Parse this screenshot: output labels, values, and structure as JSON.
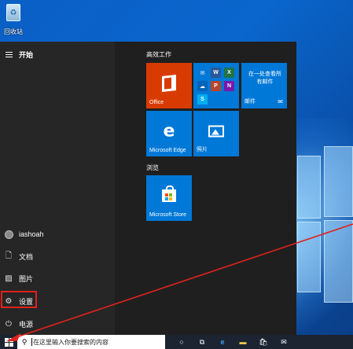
{
  "desktop": {
    "recycle_bin_label": "回收站"
  },
  "start_menu": {
    "header_label": "开始",
    "user_name": "iashoah",
    "nav_items": [
      {
        "label": "文档",
        "icon": "document-icon"
      },
      {
        "label": "图片",
        "icon": "pictures-icon"
      },
      {
        "label": "设置",
        "icon": "gear-icon"
      },
      {
        "label": "电源",
        "icon": "power-icon"
      }
    ],
    "groups": [
      {
        "title": "高效工作"
      },
      {
        "title": "浏览"
      }
    ],
    "tiles": {
      "office": "Office",
      "mail_text": "在一处查看所有邮件",
      "mail_label": "邮件",
      "edge": "Microsoft Edge",
      "photos": "照片",
      "store": "Microsoft Store"
    }
  },
  "taskbar": {
    "search_placeholder": "在这里输入你要搜索的内容"
  },
  "colors": {
    "annotation": "#e0221c",
    "tile_blue": "#0078d7",
    "office_orange": "#d83b01"
  }
}
